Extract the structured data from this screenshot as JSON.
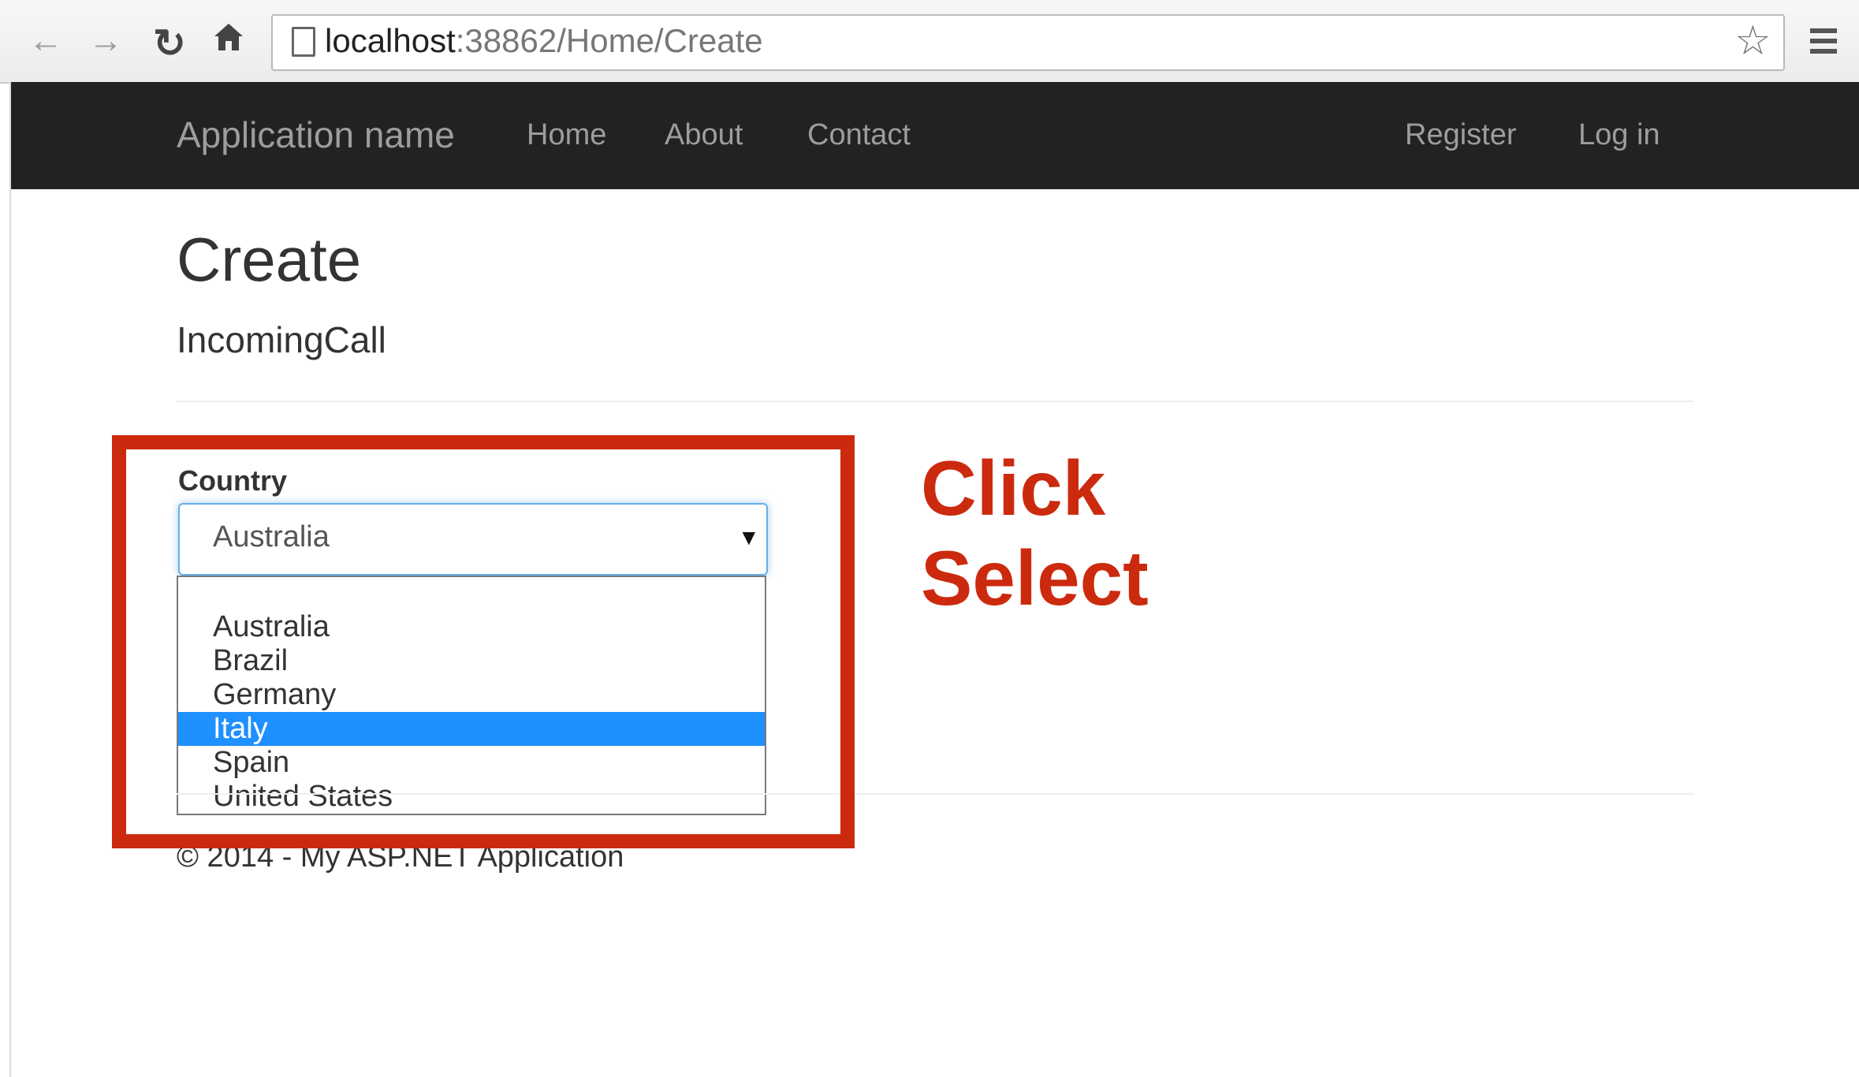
{
  "browser": {
    "url_host": "localhost",
    "url_rest": ":38862/Home/Create",
    "icons": {
      "back": "arrow-left-icon",
      "forward": "arrow-right-icon",
      "reload": "reload-icon",
      "home": "home-icon",
      "page": "page-icon",
      "star": "star-icon",
      "menu": "hamburger-menu-icon"
    }
  },
  "navbar": {
    "brand": "Application name",
    "links": [
      "Home",
      "About",
      "Contact"
    ],
    "right_links": [
      "Register",
      "Log in"
    ]
  },
  "page": {
    "title": "Create",
    "subtitle": "IncomingCall"
  },
  "form": {
    "country_label": "Country",
    "selected_value": "Australia",
    "options": [
      "Australia",
      "Brazil",
      "Germany",
      "Italy",
      "Spain",
      "United States"
    ],
    "highlighted_option": "Italy"
  },
  "footer": {
    "text": "© 2014 - My ASP.NET Application"
  },
  "annotation": {
    "line1": "Click",
    "line2": "Select",
    "color": "#cc2a0e"
  },
  "colors": {
    "navbar_bg": "#222222",
    "nav_text": "#9d9d9d",
    "option_highlight": "#1e90ff"
  }
}
